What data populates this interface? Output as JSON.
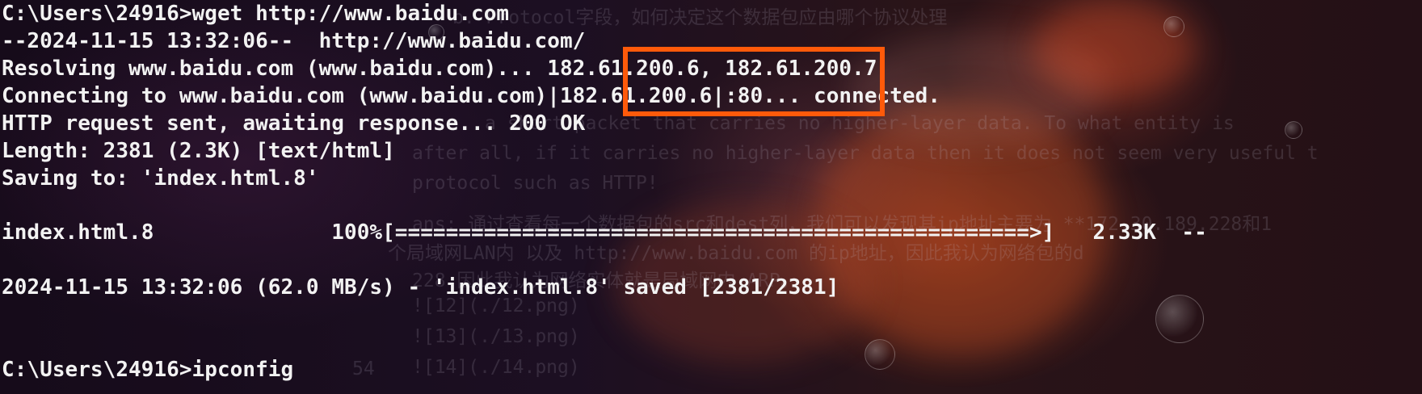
{
  "terminal": {
    "lines": [
      "C:\\Users\\24916>wget http://www.baidu.com",
      "--2024-11-15 13:32:06--  http://www.baidu.com/",
      "Resolving www.baidu.com (www.baidu.com)... 182.61.200.6, 182.61.200.7",
      "Connecting to www.baidu.com (www.baidu.com)|182.61.200.6|:80... connected.",
      "HTTP request sent, awaiting response... 200 OK",
      "Length: 2381 (2.3K) [text/html]",
      "Saving to: 'index.html.8'",
      "",
      "index.html.8              100%[==================================================>]   2.33K  --",
      "",
      "2024-11-15 13:32:06 (62.0 MB/s) - 'index.html.8' saved [2381/2381]",
      "",
      "",
      "C:\\Users\\24916>ipconfig"
    ]
  },
  "highlight": {
    "color": "#ff5a0a"
  },
  "background_text": {
    "lines": [
      "b. Protocol字段，如何决定这个数据包应由哪个协议处理",
      "a short packet that carries no higher-layer data. To what entity is",
      "after all, if it carries no higher-layer data then it does not seem very useful t",
      "protocol such as HTTP!",
      "ans: 通过查看每一个数据包的src和dest列，我们可以发现其ip地址主要为 **172.30.189.228和1",
      "个局域网LAN内 以及 http://www.baidu.com 的ip地址，因此我认为网络包的d",
      "228 因此我认为网络实体就是局域网内 ARP。",
      "![12](./12.png)",
      "![13](./13.png)",
      "![14](./14.png)",
      "54"
    ]
  }
}
